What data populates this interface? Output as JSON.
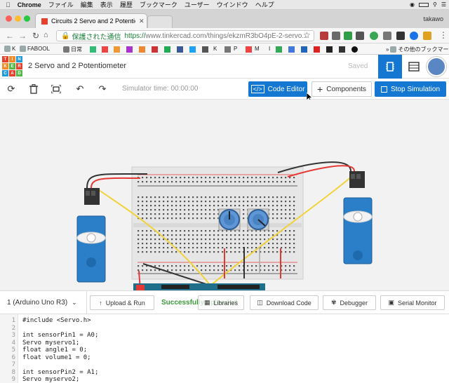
{
  "menubar": {
    "app": "Chrome",
    "items": [
      "ファイル",
      "編集",
      "表示",
      "履歴",
      "ブックマーク",
      "ユーザー",
      "ウインドウ",
      "ヘルプ"
    ]
  },
  "browser": {
    "tab_title": "Circuits 2 Servo and 2 Potentio",
    "profile": "takawo",
    "secure_label": "保護された通信",
    "url_https": "https://",
    "url_rest": "www.tinkercad.com/things/ekzmR3bO4pE-2-servo...",
    "bookmarks": [
      "K",
      "FABOOL",
      "日常",
      "K",
      "P",
      "M",
      "I",
      "その他のブックマーク"
    ]
  },
  "header": {
    "logo": [
      "TIN",
      "KER",
      "CAD"
    ],
    "project_title": "2 Servo and 2 Potentiometer",
    "saved": "Saved"
  },
  "toolbar": {
    "sim_time": "Simulator time: 00:00:00",
    "code_editor": "Code Editor",
    "components": "Components",
    "stop_simulation": "Stop Simulation"
  },
  "code_toolbar": {
    "board": "1 (Arduino Uno R3)",
    "upload_run": "Upload & Run",
    "success": "Successfully uploaded",
    "libraries": "Libraries",
    "download_code": "Download Code",
    "debugger": "Debugger",
    "serial_monitor": "Serial Monitor"
  },
  "editor": {
    "lines": [
      {
        "n": "1",
        "text": "#include <Servo.h>"
      },
      {
        "n": "2",
        "text": ""
      },
      {
        "n": "3",
        "text": "int sensorPin1 = A0;"
      },
      {
        "n": "4",
        "text": "Servo myservo1;"
      },
      {
        "n": "5",
        "text": "float angle1 = 0;"
      },
      {
        "n": "6",
        "text": "float volume1 = 0;"
      },
      {
        "n": "7",
        "text": ""
      },
      {
        "n": "8",
        "text": "int sensorPin2 = A1;"
      },
      {
        "n": "9",
        "text": "Servo myservo2;"
      }
    ]
  },
  "colors": {
    "accent": "#1477d2",
    "success": "#3b9a3b",
    "servo_blue": "#2a7fc8",
    "wire_red": "#e53935",
    "wire_yellow": "#f2d23b",
    "wire_black": "#333333"
  }
}
